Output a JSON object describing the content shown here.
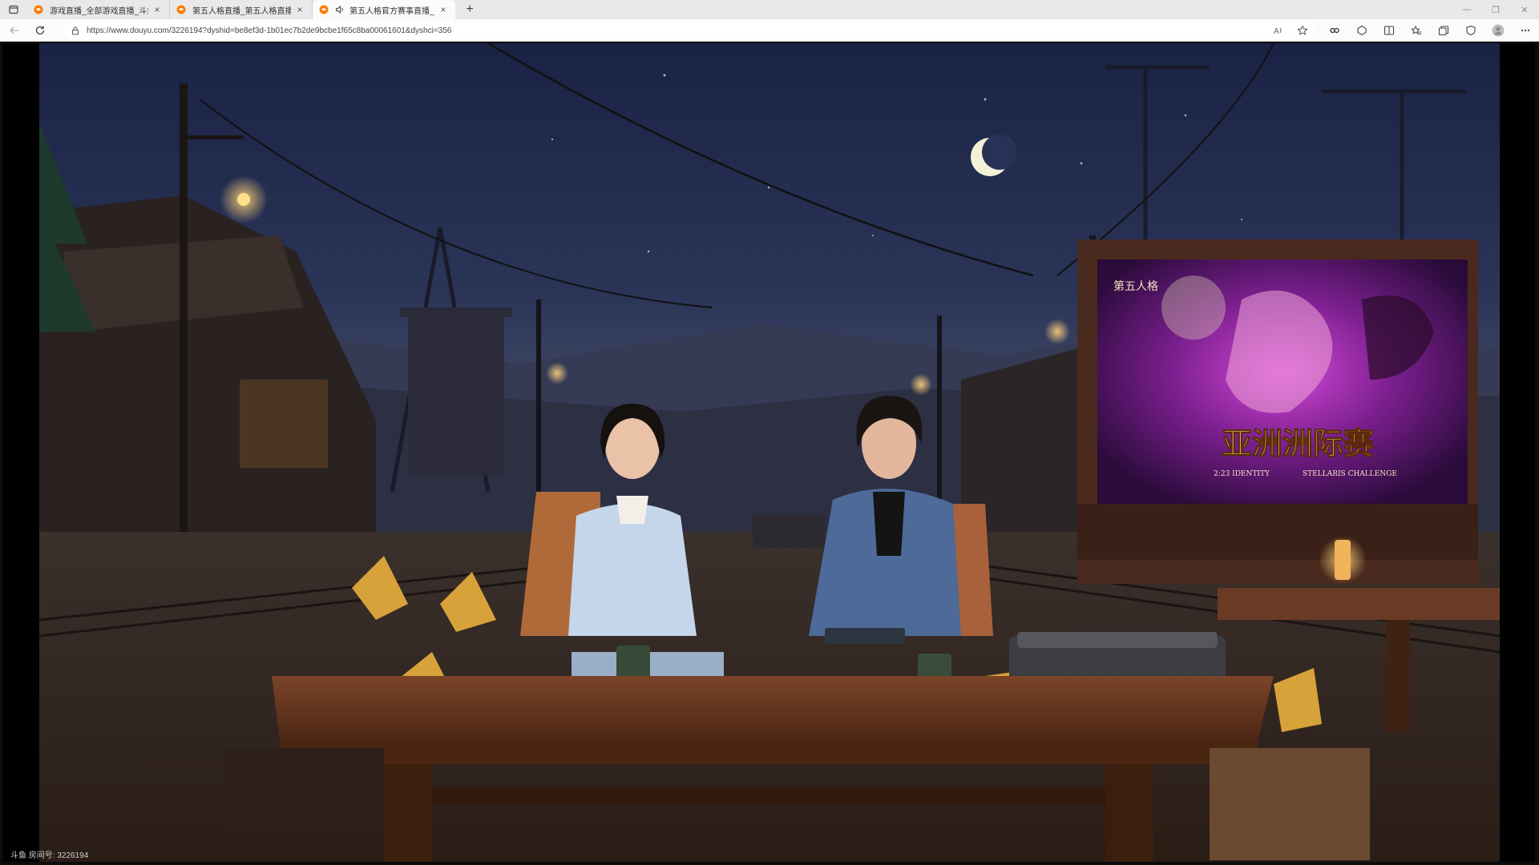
{
  "tabs": [
    {
      "title": "游戏直播_全部游戏直播_斗鱼直播",
      "active": false,
      "audio": false
    },
    {
      "title": "第五人格直播_第五人格直播解说",
      "active": false,
      "audio": false
    },
    {
      "title": "第五人格官方赛事直播_第五人格",
      "active": true,
      "audio": true
    }
  ],
  "address": {
    "url": "https://www.douyu.com/3226194?dyshid=be8ef3d-1b01ec7b2de9bcbe1f65c8ba00061601&dyshci=356"
  },
  "stream": {
    "billboard_title": "亚洲洲际赛",
    "billboard_subtitle_left": "2:23 IDENTITY",
    "billboard_subtitle_right": "STELLARIS CHALLENGE",
    "billboard_logo": "第五人格",
    "room_id": "斗鱼 房间号: 3226194"
  },
  "colors": {
    "tabstrip": "#e9e9e9",
    "toolbar": "#fbfbfb",
    "night_sky": "#1b2140",
    "table_wood": "#6b3b22",
    "billboard_purple": "#8d2aa6"
  },
  "icons": [
    "tab-actions-icon",
    "douyu-favicon",
    "speaker-icon",
    "close-icon",
    "new-tab-icon",
    "back-icon",
    "refresh-icon",
    "lock-icon",
    "read-aloud-icon",
    "favorite-star-icon",
    "extensions-icon",
    "split-screen-icon",
    "favorites-icon",
    "collections-icon",
    "profile-avatar-icon",
    "more-menu-icon"
  ]
}
